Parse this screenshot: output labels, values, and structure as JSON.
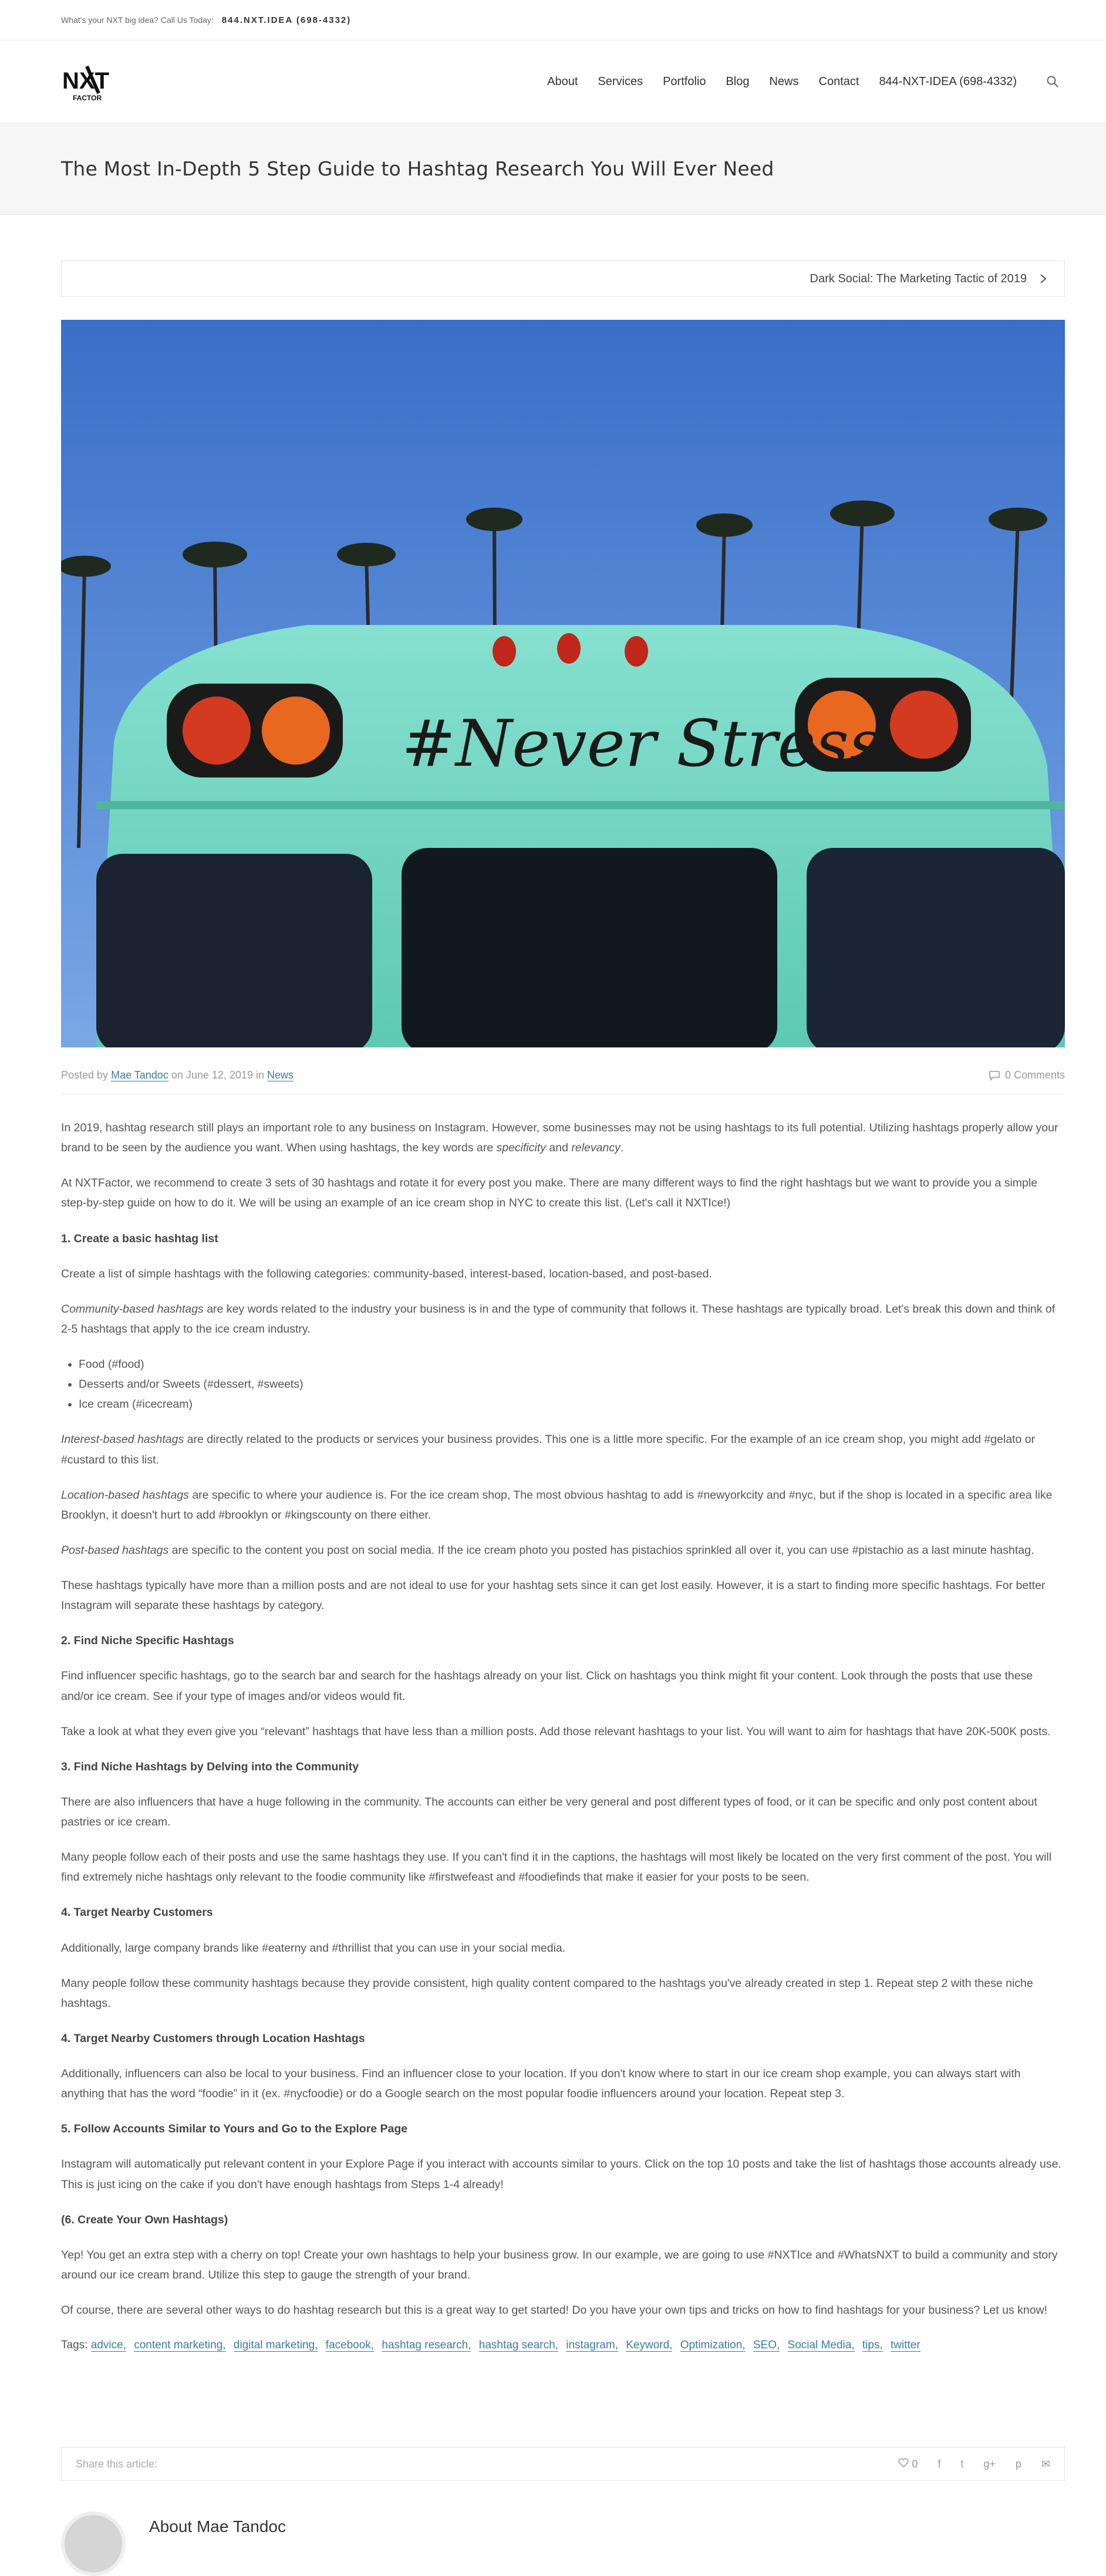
{
  "topbar": {
    "tagline": "What's your NXT big idea?   Call Us Today:",
    "phone": "844.NXT.IDEA (698-4332)"
  },
  "logo": {
    "alt": "NXT Factor",
    "text_main": "NXT",
    "text_sub": "FACTOR"
  },
  "nav": {
    "items": [
      "About",
      "Services",
      "Portfolio",
      "Blog",
      "News",
      "Contact",
      "844-NXT-IDEA (698-4332)"
    ]
  },
  "page": {
    "title": "The Most In-Depth 5 Step Guide to Hashtag Research You Will Ever Need"
  },
  "postnav": {
    "next_label": "Dark Social: The Marketing Tactic of 2019"
  },
  "hero": {
    "caption": "#Never Stress"
  },
  "meta": {
    "posted_by": "Posted by",
    "author": "Mae Tandoc",
    "on": "on June 12, 2019 in",
    "category": "News",
    "comments": "0 Comments"
  },
  "article": {
    "p1a": "In 2019, hashtag research still plays an important role to any business on Instagram. However, some businesses may not be using hashtags to its full potential. Utilizing hashtags properly allow your brand to be seen by the audience you want. When using hashtags, the key words are ",
    "p1b": "specificity",
    "p1c": " and ",
    "p1d": "relevancy",
    "p1e": ".",
    "p2": "At NXTFactor, we recommend to create 3 sets of 30 hashtags and rotate it for every post you make. There are many different ways to find the right hashtags but we want to provide you a simple step-by-step guide on how to do it. We will be using an example of an ice cream shop in NYC to create this list. (Let's call it NXTIce!)",
    "h1": "1.  Create a basic hashtag list",
    "p3": "Create a list of simple hashtags with the following categories: community-based, interest-based, location-based, and post-based.",
    "p4a": "Community-based hashtags",
    "p4b": " are key words related to the industry your business is in and the type of community that follows it. These hashtags are typically broad. Let's break this down  and think of 2-5 hashtags that apply to the ice cream industry.",
    "list": [
      "Food (#food)",
      "Desserts and/or Sweets (#dessert, #sweets)",
      "Ice cream (#icecream)"
    ],
    "p5a": "Interest-based hashtags",
    "p5b": " are directly related to the products or services your business provides. This one is a little more specific. For the example of an ice cream shop, you might add #gelato or #custard to this list.",
    "p6a": "Location-based hashtags",
    "p6b": " are specific to where your audience is. For the ice cream shop, The most obvious hashtag to add is #newyorkcity and #nyc, but if the shop is located in a specific area like Brooklyn, it doesn't hurt to add #brooklyn or #kingscounty on there either.",
    "p7a": "Post-based hashtags",
    "p7b": " are specific to the content you post on social media. If the ice cream photo you posted has pistachios sprinkled all over it, you can use #pistachio as a last minute hashtag.",
    "p8": "These hashtags typically have more than a million posts and are not ideal to use for your hashtag sets since it can get lost easily. However, it is a start to finding more specific hashtags. For better Instagram will separate these hashtags by category.",
    "h2": "2.  Find Niche Specific Hashtags",
    "p9": "Find influencer specific hashtags, go to the search bar and search for the hashtags already on your list. Click on hashtags you think might fit your content. Look through the posts that use these and/or ice cream. See if your type of images and/or videos would fit.",
    "p10": "Take a look at what they even give you “relevant” hashtags that have less than a million posts. Add those relevant hashtags to your list. You will want to aim for hashtags that have 20K-500K posts.",
    "h3": "3.  Find Niche Hashtags by Delving into the Community",
    "p11": "There are also influencers that have a huge following in the community. The accounts can either be very general and post different types of food, or it can be specific and only post content about pastries or ice cream.",
    "p12": "Many people follow each of their posts and use the same hashtags they use. If you can't find it in the captions, the hashtags will most likely be located on the very first comment of the post. You will find extremely niche hashtags only relevant to the foodie community like #firstwefeast and #foodiefinds that make it easier for your posts to be seen.",
    "h3b": "4.  Target Nearby Customers",
    "p13": "Additionally, large company brands like #eaterny and #thrillist that you can use in your social media.",
    "p14": "Many people follow these community hashtags because they provide consistent, high quality content compared to the hashtags you've already created in step 1. Repeat step 2 with these niche hashtags.",
    "h4": "4.  Target Nearby Customers through Location Hashtags",
    "p15": "Additionally, influencers can also be local to your business. Find an influencer close to your location. If you don't know where to start in our ice cream shop example, you can always start with anything that has the word “foodie” in it (ex. #nycfoodie) or do a Google search on the most popular foodie influencers around your location. Repeat step 3.",
    "h5": "5.  Follow Accounts Similar to Yours and Go to the Explore Page",
    "p16": "Instagram will automatically put relevant content in your Explore Page if you interact with accounts similar to yours. Click on the top 10 posts and take the list of hashtags those accounts already use. This is just icing on the cake if you don't have enough hashtags from Steps 1-4 already!",
    "h6": "(6. Create Your Own Hashtags)",
    "p17": "Yep! You get an extra step with a cherry on top! Create your own hashtags to help your business grow. In our example, we are going to use #NXTIce and #WhatsNXT to build a community and story around our ice cream brand. Utilize this step to gauge the strength of your brand.",
    "p18": "Of course, there are several other ways to do hashtag research but this is a great way to get started! Do you have your own tips and tricks on how to find hashtags for your business? Let us know!"
  },
  "tags": {
    "label": "Tags:",
    "items": [
      "advice,",
      "content marketing,",
      "digital marketing,",
      "facebook,",
      "hashtag research,",
      "hashtag search,",
      "instagram,",
      "Keyword,",
      "Optimization,",
      "SEO,",
      "Social Media,",
      "tips,",
      "twitter"
    ]
  },
  "share": {
    "label": "Share this article:",
    "likes": "0"
  },
  "author_box": {
    "heading": "About Mae Tandoc"
  }
}
